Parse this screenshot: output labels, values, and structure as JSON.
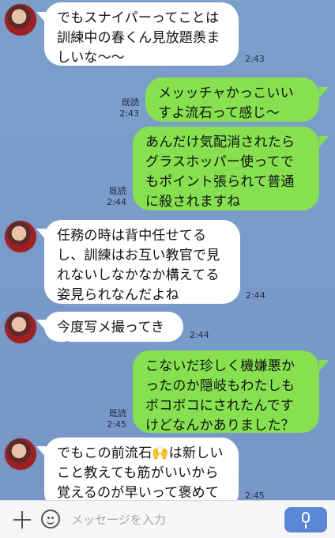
{
  "chat": {
    "messages": [
      {
        "id": "m1",
        "side": "in",
        "text": "でもスナイパーってことは訓練中の春くん見放題羨ましいな〜〜",
        "time": "2:43"
      },
      {
        "id": "m2",
        "side": "out",
        "text": "メッッチャかっこいいすよ流石って感じ〜",
        "read": "既読",
        "time": "2:43"
      },
      {
        "id": "m3",
        "side": "out",
        "text": "あんだけ気配消されたらグラスホッパー使ってでもポイント張られて普通に殺されますね",
        "read": "既読",
        "time": "2:44"
      },
      {
        "id": "m4",
        "side": "in",
        "text": "任務の時は背中任せてるし、訓練はお互い教官で見れないしなかなか構えてる姿見られなんだよね",
        "time": "2:44"
      },
      {
        "id": "m5",
        "side": "in",
        "text": "今度写メ撮ってきて",
        "time": "2:44"
      },
      {
        "id": "m6",
        "side": "out",
        "text": "こないだ珍しく機嫌悪かったのか隠岐もわたしもボコボコにされたんですけどなんかありました？",
        "read": "既読",
        "time": "2:45"
      },
      {
        "id": "m7",
        "side": "in",
        "text": "でもこの前流石🙌は新しいこと教えても筋がいいから覚えるのが早いって褒めてたよ",
        "time": "2:45"
      }
    ]
  },
  "composer": {
    "placeholder": "メッセージを入力",
    "icons": {
      "add": "plus-icon",
      "emoji": "emoji-icon",
      "mic": "microphone-icon"
    }
  },
  "colors": {
    "background": "#7a9cca",
    "incoming": "#ffffff",
    "outgoing": "#86e04f",
    "micButton": "#5b86d6"
  }
}
